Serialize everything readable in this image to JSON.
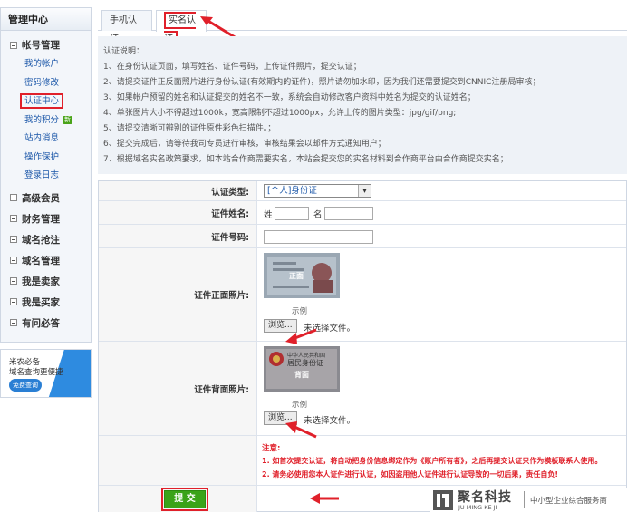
{
  "sidebar": {
    "title": "管理中心",
    "account_group": "帐号管理",
    "account_items": [
      "我的帐户",
      "密码修改",
      "认证中心",
      "我的积分",
      "站内消息",
      "操作保护",
      "登录日志"
    ],
    "new_badge": "新",
    "groups": [
      "高级会员",
      "财务管理",
      "域名抢注",
      "域名管理",
      "我是卖家",
      "我是买家",
      "有问必答"
    ]
  },
  "ad": {
    "line1": "米农必备",
    "line2": "域名查询更便捷",
    "button": "免费查询"
  },
  "tabs": {
    "phone": "手机认证",
    "realname": "实名认证"
  },
  "notes": [
    "认证说明：",
    "1、在身份认证页面，填写姓名、证件号码，上传证件照片，提交认证；",
    "2、请提交证件正反面照片进行身份认证(有效期内的证件)，照片请勿加水印，因为我们还需要提交到CNNIC注册局审核；",
    "3、如果帐户预留的姓名和认证提交的姓名不一致，系统会自动修改客户资料中姓名为提交的认证姓名；",
    "4、单张图片大小不得超过1000k，宽高限制不超过1000px，允许上传的图片类型：jpg/gif/png;",
    "5、请提交清晰可辨别的证件原件彩色扫描件。；",
    "6、提交完成后，请等待我司专员进行审核，审核结果会以邮件方式通知用户；",
    "7、根据域名实名政策要求，如本站合作商需要实名，本站会提交您的实名材料到合作商平台由合作商提交实名；"
  ],
  "form": {
    "type_label": "认证类型:",
    "type_value": "[个人]身份证",
    "name_label": "证件姓名:",
    "surname_label": "姓",
    "given_label": "名",
    "number_label": "证件号码:",
    "front_label": "证件正面照片:",
    "back_label": "证件背面照片:",
    "front_photo_text": "正面",
    "back_photo_text": "背面",
    "back_photo_title": "中华人民共和国",
    "back_photo_sub": "居民身份证",
    "sample": "示例",
    "browse": "浏览...",
    "no_file": "未选择文件。",
    "notice_title": "注意:",
    "notice_1": "1. 如首次提交认证，将自动把身份信息绑定作为《账户所有者》，之后再提交认证只作为模板联系人使用。",
    "notice_2": "2. 请务必使用您本人证件进行认证，如因盗用他人证件进行认证导致的一切后果，责任自负!",
    "submit": "提 交"
  },
  "watermark": {
    "brand": "聚名科技",
    "pinyin": "JU MING KE JI",
    "slogan": "中小型企业综合服务商"
  },
  "colors": {
    "accent_red": "#e0202a",
    "link_blue": "#1a56a8",
    "submit_green": "#3aa318",
    "panel_bg": "#eef2f7"
  }
}
